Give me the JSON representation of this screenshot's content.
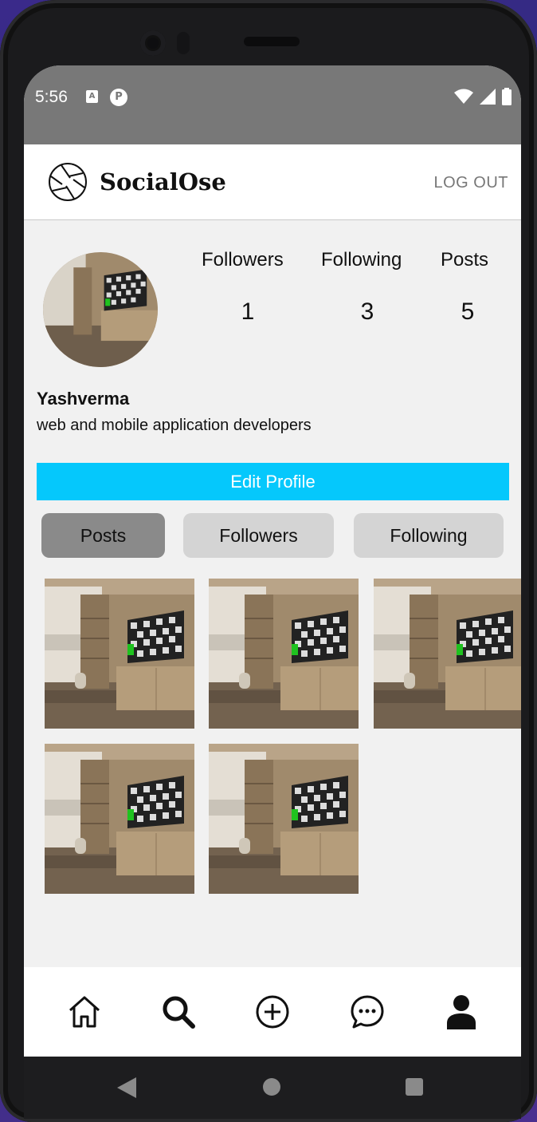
{
  "status_bar": {
    "time": "5:56",
    "notif_a": "A",
    "notif_p": "P"
  },
  "app_bar": {
    "brand": "SocialOse",
    "logout_label": "LOG OUT"
  },
  "profile": {
    "stats": [
      {
        "label": "Followers",
        "value": "1"
      },
      {
        "label": "Following",
        "value": "3"
      },
      {
        "label": "Posts",
        "value": "5"
      }
    ],
    "username": "Yashverma",
    "bio": "web and mobile application developers",
    "edit_label": "Edit Profile"
  },
  "tabs": [
    {
      "label": "Posts",
      "active": true
    },
    {
      "label": "Followers",
      "active": false
    },
    {
      "label": "Following",
      "active": false
    }
  ],
  "posts_count_visible": 5,
  "bottom_nav": [
    "home-icon",
    "search-icon",
    "add-post-icon",
    "chat-icon",
    "profile-icon"
  ],
  "colors": {
    "accent": "#05c8fc",
    "status_bar": "#787878",
    "active_tab": "#8a8a8a",
    "inactive_tab": "#d4d4d4"
  }
}
